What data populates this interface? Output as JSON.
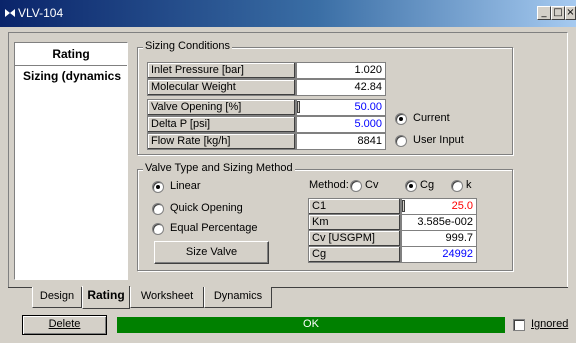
{
  "window": {
    "title": "VLV-104",
    "min": "_",
    "restore": "□",
    "close": "×"
  },
  "nav": {
    "items": [
      {
        "label": "Rating"
      },
      {
        "label": "Sizing (dynamics"
      }
    ]
  },
  "sizing_conditions": {
    "legend": "Sizing Conditions",
    "rows": [
      {
        "label": "Inlet Pressure [bar]",
        "value": "1.020"
      },
      {
        "label": "Molecular Weight",
        "value": "42.84"
      }
    ],
    "input_rows": [
      {
        "label": "Valve Opening [%]",
        "value": "50.00"
      },
      {
        "label": "Delta P [psi]",
        "value": "5.000"
      },
      {
        "label": "Flow Rate [kg/h]",
        "value": "8841"
      }
    ],
    "source_options": [
      {
        "label": "Current",
        "selected": true
      },
      {
        "label": "User Input",
        "selected": false
      }
    ]
  },
  "valve_type": {
    "legend": "Valve Type and Sizing Method",
    "types": [
      {
        "label": "Linear",
        "selected": true
      },
      {
        "label": "Quick Opening",
        "selected": false
      },
      {
        "label": "Equal Percentage",
        "selected": false
      }
    ],
    "size_button": "Size Valve",
    "method_label": "Method:",
    "methods": [
      {
        "label": "Cv",
        "selected": false
      },
      {
        "label": "Cg",
        "selected": true
      },
      {
        "label": "k",
        "selected": false
      }
    ],
    "coeffs": [
      {
        "label": "C1",
        "value": "25.0",
        "color": "#ff0000"
      },
      {
        "label": "Km",
        "value": "3.585e-002",
        "color": "#000000"
      },
      {
        "label": "Cv [USGPM]",
        "value": "999.7",
        "color": "#000000"
      },
      {
        "label": "Cg",
        "value": "24992",
        "color": "#0000ff"
      }
    ]
  },
  "tabs": [
    {
      "label": "Design",
      "active": false
    },
    {
      "label": "Rating",
      "active": true
    },
    {
      "label": "Worksheet",
      "active": false
    },
    {
      "label": "Dynamics",
      "active": false
    }
  ],
  "footer": {
    "delete_label": "Delete",
    "status": "OK",
    "status_color": "#008000",
    "ignored_label": "Ignored",
    "ignored_checked": false
  }
}
